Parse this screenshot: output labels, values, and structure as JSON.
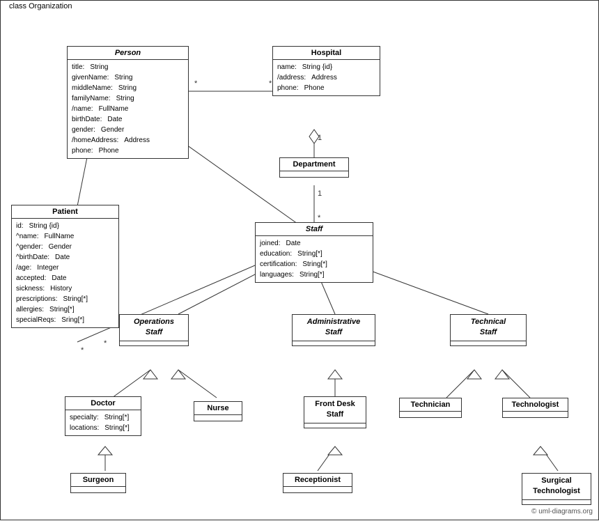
{
  "diagram": {
    "title": "class Organization",
    "copyright": "© uml-diagrams.org",
    "classes": {
      "person": {
        "name": "Person",
        "italic": true,
        "attributes": [
          {
            "name": "title:",
            "type": "String"
          },
          {
            "name": "givenName:",
            "type": "String"
          },
          {
            "name": "middleName:",
            "type": "String"
          },
          {
            "name": "familyName:",
            "type": "String"
          },
          {
            "name": "/name:",
            "type": "FullName"
          },
          {
            "name": "birthDate:",
            "type": "Date"
          },
          {
            "name": "gender:",
            "type": "Gender"
          },
          {
            "name": "/homeAddress:",
            "type": "Address"
          },
          {
            "name": "phone:",
            "type": "Phone"
          }
        ]
      },
      "hospital": {
        "name": "Hospital",
        "italic": false,
        "attributes": [
          {
            "name": "name:",
            "type": "String {id}"
          },
          {
            "name": "/address:",
            "type": "Address"
          },
          {
            "name": "phone:",
            "type": "Phone"
          }
        ]
      },
      "department": {
        "name": "Department",
        "italic": false,
        "attributes": []
      },
      "staff": {
        "name": "Staff",
        "italic": true,
        "attributes": [
          {
            "name": "joined:",
            "type": "Date"
          },
          {
            "name": "education:",
            "type": "String[*]"
          },
          {
            "name": "certification:",
            "type": "String[*]"
          },
          {
            "name": "languages:",
            "type": "String[*]"
          }
        ]
      },
      "patient": {
        "name": "Patient",
        "italic": false,
        "attributes": [
          {
            "name": "id:",
            "type": "String {id}"
          },
          {
            "name": "^name:",
            "type": "FullName"
          },
          {
            "name": "^gender:",
            "type": "Gender"
          },
          {
            "name": "^birthDate:",
            "type": "Date"
          },
          {
            "name": "/age:",
            "type": "Integer"
          },
          {
            "name": "accepted:",
            "type": "Date"
          },
          {
            "name": "sickness:",
            "type": "History"
          },
          {
            "name": "prescriptions:",
            "type": "String[*]"
          },
          {
            "name": "allergies:",
            "type": "String[*]"
          },
          {
            "name": "specialReqs:",
            "type": "Sring[*]"
          }
        ]
      },
      "operations_staff": {
        "name": "Operations\nStaff",
        "italic": true,
        "attributes": []
      },
      "administrative_staff": {
        "name": "Administrative\nStaff",
        "italic": true,
        "attributes": []
      },
      "technical_staff": {
        "name": "Technical\nStaff",
        "italic": true,
        "attributes": []
      },
      "doctor": {
        "name": "Doctor",
        "italic": false,
        "attributes": [
          {
            "name": "specialty:",
            "type": "String[*]"
          },
          {
            "name": "locations:",
            "type": "String[*]"
          }
        ]
      },
      "nurse": {
        "name": "Nurse",
        "italic": false,
        "attributes": []
      },
      "front_desk_staff": {
        "name": "Front Desk\nStaff",
        "italic": false,
        "attributes": []
      },
      "technician": {
        "name": "Technician",
        "italic": false,
        "attributes": []
      },
      "technologist": {
        "name": "Technologist",
        "italic": false,
        "attributes": []
      },
      "surgeon": {
        "name": "Surgeon",
        "italic": false,
        "attributes": []
      },
      "receptionist": {
        "name": "Receptionist",
        "italic": false,
        "attributes": []
      },
      "surgical_technologist": {
        "name": "Surgical\nTechnologist",
        "italic": false,
        "attributes": []
      }
    }
  }
}
